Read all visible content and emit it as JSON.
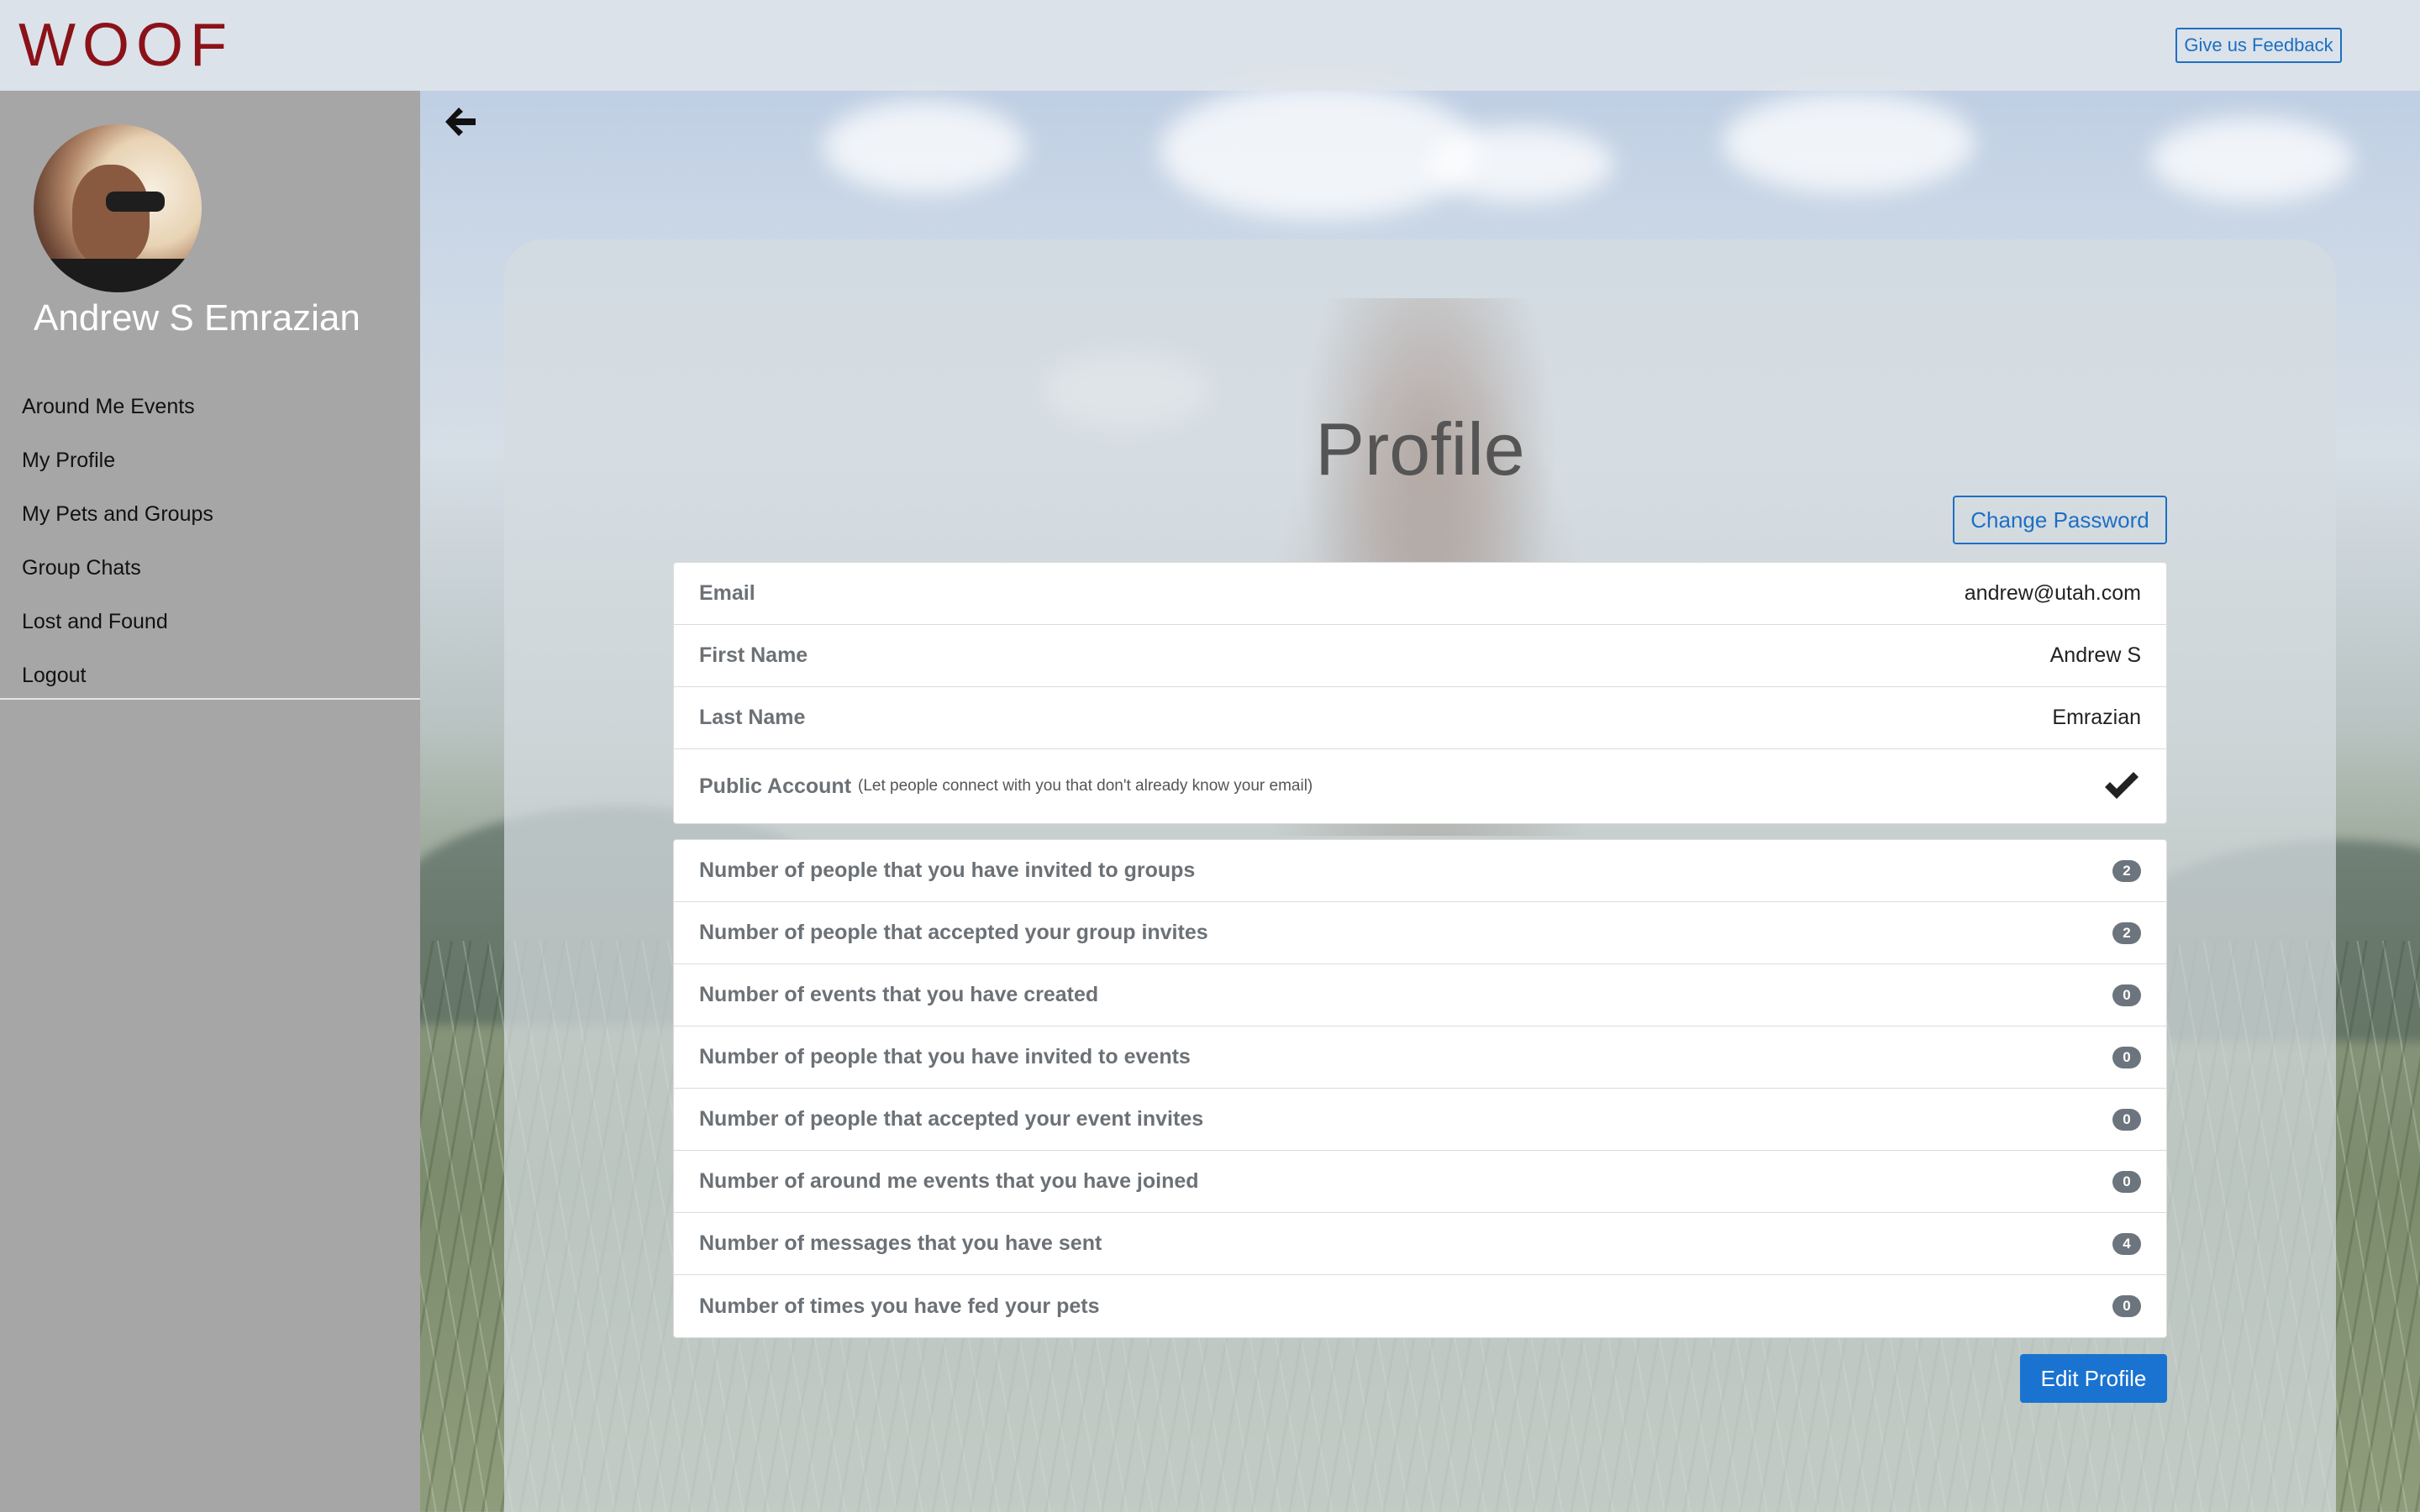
{
  "brand": {
    "logo_text": "WOOF",
    "logo_color": "#8b1219"
  },
  "header": {
    "feedback_label": "Give us Feedback"
  },
  "user": {
    "name": "Andrew S Emrazian"
  },
  "sidebar": {
    "items": [
      {
        "label": "Around Me Events"
      },
      {
        "label": "My Profile"
      },
      {
        "label": "My Pets and Groups"
      },
      {
        "label": "Group Chats"
      },
      {
        "label": "Lost and Found"
      },
      {
        "label": "Logout"
      }
    ]
  },
  "profile": {
    "title": "Profile",
    "change_password_label": "Change Password",
    "fields": [
      {
        "label": "Email",
        "value": "andrew@utah.com"
      },
      {
        "label": "First Name",
        "value": "Andrew S"
      },
      {
        "label": "Last Name",
        "value": "Emrazian"
      }
    ],
    "public_account": {
      "label": "Public Account",
      "note": "(Let people connect with you that don't already know your email)",
      "checked": true,
      "icon": "check-icon"
    },
    "stats": [
      {
        "label": "Number of people that you have invited to groups",
        "count": "2"
      },
      {
        "label": "Number of people that accepted your group invites",
        "count": "2"
      },
      {
        "label": "Number of events that you have created",
        "count": "0"
      },
      {
        "label": "Number of people that you have invited to events",
        "count": "0"
      },
      {
        "label": "Number of people that accepted your event invites",
        "count": "0"
      },
      {
        "label": "Number of around me events that you have joined",
        "count": "0"
      },
      {
        "label": "Number of messages that you have sent",
        "count": "4"
      },
      {
        "label": "Number of times you have fed your pets",
        "count": "0"
      }
    ],
    "edit_label": "Edit Profile"
  },
  "colors": {
    "accent": "#1a73d0",
    "badge": "#6c757d",
    "sidebar": "#a6a6a6"
  },
  "icons": {
    "back": "arrow-left-icon",
    "check": "check-icon"
  }
}
